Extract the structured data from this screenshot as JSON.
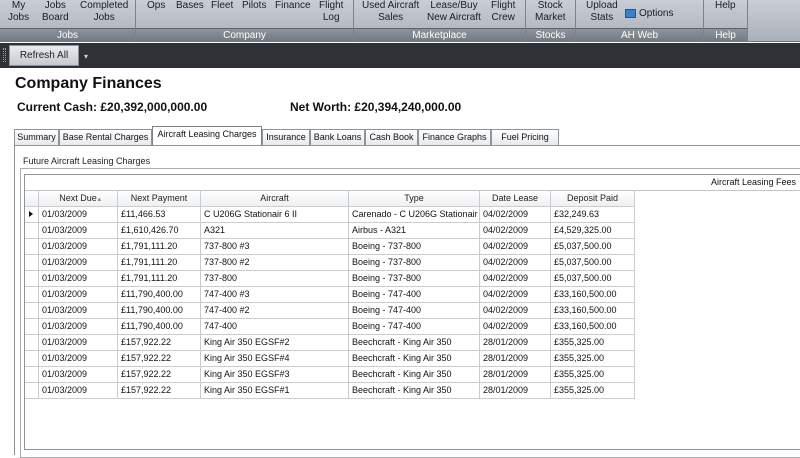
{
  "ribbon": {
    "groups": [
      {
        "label": "Jobs",
        "items": [
          {
            "name": "my-jobs",
            "lines": [
              "My",
              "Jobs"
            ]
          },
          {
            "name": "jobs-board",
            "lines": [
              "Jobs",
              "Board"
            ]
          },
          {
            "name": "completed-jobs",
            "lines": [
              "Completed",
              "Jobs"
            ]
          }
        ]
      },
      {
        "label": "Company",
        "items": [
          {
            "name": "ops",
            "lines": [
              "Ops",
              ""
            ]
          },
          {
            "name": "bases",
            "lines": [
              "Bases",
              ""
            ]
          },
          {
            "name": "fleet",
            "lines": [
              "Fleet",
              ""
            ]
          },
          {
            "name": "pilots",
            "lines": [
              "Pilots",
              ""
            ]
          },
          {
            "name": "finance",
            "lines": [
              "Finance",
              ""
            ]
          },
          {
            "name": "flight-log",
            "lines": [
              "Flight",
              "Log"
            ]
          }
        ]
      },
      {
        "label": "Marketplace",
        "items": [
          {
            "name": "used-aircraft-sales",
            "lines": [
              "Used Aircraft",
              "Sales"
            ]
          },
          {
            "name": "lease-buy-new-aircraft",
            "lines": [
              "Lease/Buy",
              "New Aircraft"
            ]
          },
          {
            "name": "flight-crew",
            "lines": [
              "Flight",
              "Crew"
            ]
          }
        ]
      },
      {
        "label": "Stocks",
        "items": [
          {
            "name": "stock-market",
            "lines": [
              "Stock",
              "Market"
            ]
          }
        ]
      },
      {
        "label": "AH Web",
        "items": [
          {
            "name": "upload-stats",
            "lines": [
              "Upload",
              "Stats"
            ]
          },
          {
            "name": "options",
            "lines": [
              "Options",
              ""
            ]
          }
        ]
      },
      {
        "label": "Help",
        "items": [
          {
            "name": "help",
            "lines": [
              "Help",
              ""
            ]
          }
        ]
      }
    ]
  },
  "toolbar": {
    "refresh_label": "Refresh All"
  },
  "page": {
    "title": "Company Finances",
    "current_cash": "Current Cash: £20,392,000,000.00",
    "net_worth": "Net Worth: £20,394,240,000.00"
  },
  "tabs": [
    "Summary",
    "Base Rental Charges",
    "Aircraft Leasing Charges",
    "Insurance",
    "Bank Loans",
    "Cash Book",
    "Finance Graphs",
    "Fuel Pricing"
  ],
  "active_tab": 2,
  "section_label": "Future Aircraft Leasing Charges",
  "grid": {
    "band_label": "Aircraft Leasing Fees",
    "columns": [
      "Next Due",
      "Next Payment",
      "Aircraft",
      "Type",
      "Date Lease",
      "Deposit Paid"
    ],
    "rows": [
      [
        "01/03/2009",
        "£11,466.53",
        "C U206G Stationair 6 II",
        "Carenado - C U206G Stationair",
        "04/02/2009",
        "£32,249.63"
      ],
      [
        "01/03/2009",
        "£1,610,426.70",
        "A321",
        "Airbus - A321",
        "04/02/2009",
        "£4,529,325.00"
      ],
      [
        "01/03/2009",
        "£1,791,111.20",
        "737-800 #3",
        "Boeing - 737-800",
        "04/02/2009",
        "£5,037,500.00"
      ],
      [
        "01/03/2009",
        "£1,791,111.20",
        "737-800 #2",
        "Boeing - 737-800",
        "04/02/2009",
        "£5,037,500.00"
      ],
      [
        "01/03/2009",
        "£1,791,111.20",
        "737-800",
        "Boeing - 737-800",
        "04/02/2009",
        "£5,037,500.00"
      ],
      [
        "01/03/2009",
        "£11,790,400.00",
        "747-400 #3",
        "Boeing - 747-400",
        "04/02/2009",
        "£33,160,500.00"
      ],
      [
        "01/03/2009",
        "£11,790,400.00",
        "747-400 #2",
        "Boeing - 747-400",
        "04/02/2009",
        "£33,160,500.00"
      ],
      [
        "01/03/2009",
        "£11,790,400.00",
        "747-400",
        "Boeing - 747-400",
        "04/02/2009",
        "£33,160,500.00"
      ],
      [
        "01/03/2009",
        "£157,922.22",
        "King Air 350 EGSF#2",
        "Beechcraft - King Air 350",
        "28/01/2009",
        "£355,325.00"
      ],
      [
        "01/03/2009",
        "£157,922.22",
        "King Air 350 EGSF#4",
        "Beechcraft - King Air 350",
        "28/01/2009",
        "£355,325.00"
      ],
      [
        "01/03/2009",
        "£157,922.22",
        "King Air 350 EGSF#3",
        "Beechcraft - King Air 350",
        "28/01/2009",
        "£355,325.00"
      ],
      [
        "01/03/2009",
        "£157,922.22",
        "King Air 350 EGSF#1",
        "Beechcraft - King Air 350",
        "28/01/2009",
        "£355,325.00"
      ]
    ]
  }
}
